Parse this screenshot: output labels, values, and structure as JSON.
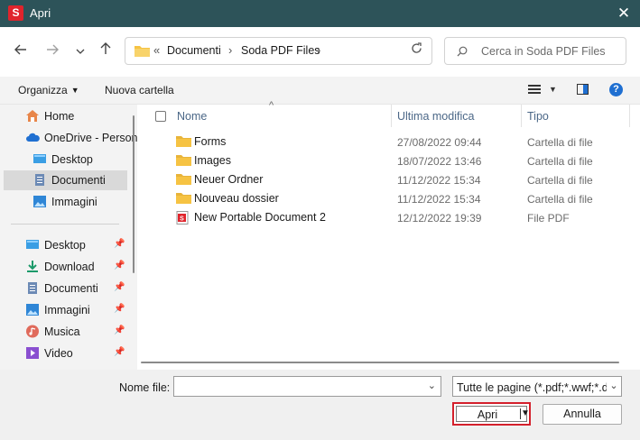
{
  "window": {
    "title": "Apri",
    "app_logo": "S",
    "close_glyph": "✕"
  },
  "nav": {
    "back_icon": "arrow-left-icon",
    "forward_icon": "arrow-right-icon",
    "history_icon": "chevron-down-icon",
    "up_icon": "arrow-up-icon"
  },
  "address": {
    "overflow": "«",
    "crumbs": [
      "Documenti",
      "Soda PDF Files"
    ],
    "separator": "›"
  },
  "search": {
    "placeholder": "Cerca in Soda PDF Files"
  },
  "toolbar": {
    "organize_label": "Organizza",
    "new_folder_label": "Nuova cartella",
    "help": "?"
  },
  "sidebar": {
    "items": [
      {
        "label": "Home",
        "icon": "home-icon"
      },
      {
        "label": "OneDrive - Personal",
        "icon": "cloud-icon"
      },
      {
        "label": "Desktop",
        "icon": "desktop-icon"
      },
      {
        "label": "Documenti",
        "icon": "document-icon",
        "selected": true
      },
      {
        "label": "Immagini",
        "icon": "image-icon"
      }
    ],
    "quick_access": [
      {
        "label": "Desktop",
        "icon": "desktop-icon",
        "pinned": true
      },
      {
        "label": "Download",
        "icon": "download-icon",
        "pinned": true
      },
      {
        "label": "Documenti",
        "icon": "document-icon",
        "pinned": true
      },
      {
        "label": "Immagini",
        "icon": "image-icon",
        "pinned": true
      },
      {
        "label": "Musica",
        "icon": "music-icon",
        "pinned": true
      },
      {
        "label": "Video",
        "icon": "video-icon",
        "pinned": true
      }
    ]
  },
  "columns": {
    "name": "Nome",
    "modified": "Ultima modifica",
    "type": "Tipo"
  },
  "files": [
    {
      "name": "Forms",
      "modified": "27/08/2022 09:44",
      "type": "Cartella di file",
      "kind": "folder"
    },
    {
      "name": "Images",
      "modified": "18/07/2022 13:46",
      "type": "Cartella di file",
      "kind": "folder"
    },
    {
      "name": "Neuer Ordner",
      "modified": "11/12/2022 15:34",
      "type": "Cartella di file",
      "kind": "folder"
    },
    {
      "name": "Nouveau dossier",
      "modified": "11/12/2022 15:34",
      "type": "Cartella di file",
      "kind": "folder"
    },
    {
      "name": "New Portable Document 2",
      "modified": "12/12/2022 19:39",
      "type": "File PDF",
      "kind": "pdf"
    }
  ],
  "footer": {
    "filename_label": "Nome file:",
    "filename_value": "",
    "filter_value": "Tutte le pagine (*.pdf;*.wwf;*.doc",
    "open_label": "Apri",
    "cancel_label": "Annulla"
  },
  "colors": {
    "titlebar": "#2d5359",
    "accent": "#1f6fd1",
    "folder": "#f6c343",
    "highlight": "#d4202c"
  }
}
